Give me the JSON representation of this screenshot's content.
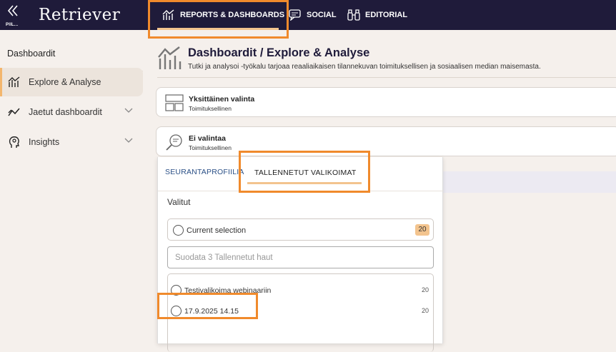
{
  "app": {
    "logo": "Retriever",
    "collapse_label": "PIIL..."
  },
  "topnav": {
    "items": [
      {
        "label": "REPORTS & DASHBOARDS",
        "icon": "bar-chart-icon",
        "active": true
      },
      {
        "label": "SOCIAL",
        "icon": "chat-icon",
        "active": false
      },
      {
        "label": "EDITORIAL",
        "icon": "binoculars-icon",
        "active": false
      }
    ]
  },
  "sidebar": {
    "title": "Dashboardit",
    "items": [
      {
        "label": "Explore & Analyse",
        "icon": "bar-chart-icon",
        "active": true
      },
      {
        "label": "Jaetut dashboardit",
        "icon": "trend-line-icon",
        "expandable": true
      },
      {
        "label": "Insights",
        "icon": "head-insight-icon",
        "expandable": true
      }
    ]
  },
  "header": {
    "title": "Dashboardit / Explore & Analyse",
    "subtitle": "Tutki ja analysoi -työkalu tarjoaa reaaliaikaisen tilannekuvan toimituksellisen ja sosiaalisen median maisemasta."
  },
  "cards": [
    {
      "title": "Yksittäinen valinta",
      "subtitle": "Toimituksellinen",
      "icon": "layout-icon"
    },
    {
      "title": "Ei valintaa",
      "subtitle": "Toimituksellinen",
      "icon": "search-icon"
    }
  ],
  "panel": {
    "tabs": [
      {
        "label": "SEURANTAPROFIILIA",
        "active": false
      },
      {
        "label": "TALLENNETUT VALIKOIMAT",
        "active": true
      }
    ],
    "selected_heading": "Valitut",
    "current_selection": {
      "label": "Current selection",
      "count": "20"
    },
    "filter_placeholder": "Suodata 3 Tallennetut haut",
    "items": [
      {
        "label": "Testivalikoima webinaariin",
        "count": "20"
      },
      {
        "label": "17.9.2025 14.15",
        "count": "20"
      }
    ]
  },
  "colors": {
    "topbar": "#1f1b3a",
    "accent": "#f3c48e",
    "highlight": "#f08a2c",
    "background": "#f5f0ec"
  }
}
